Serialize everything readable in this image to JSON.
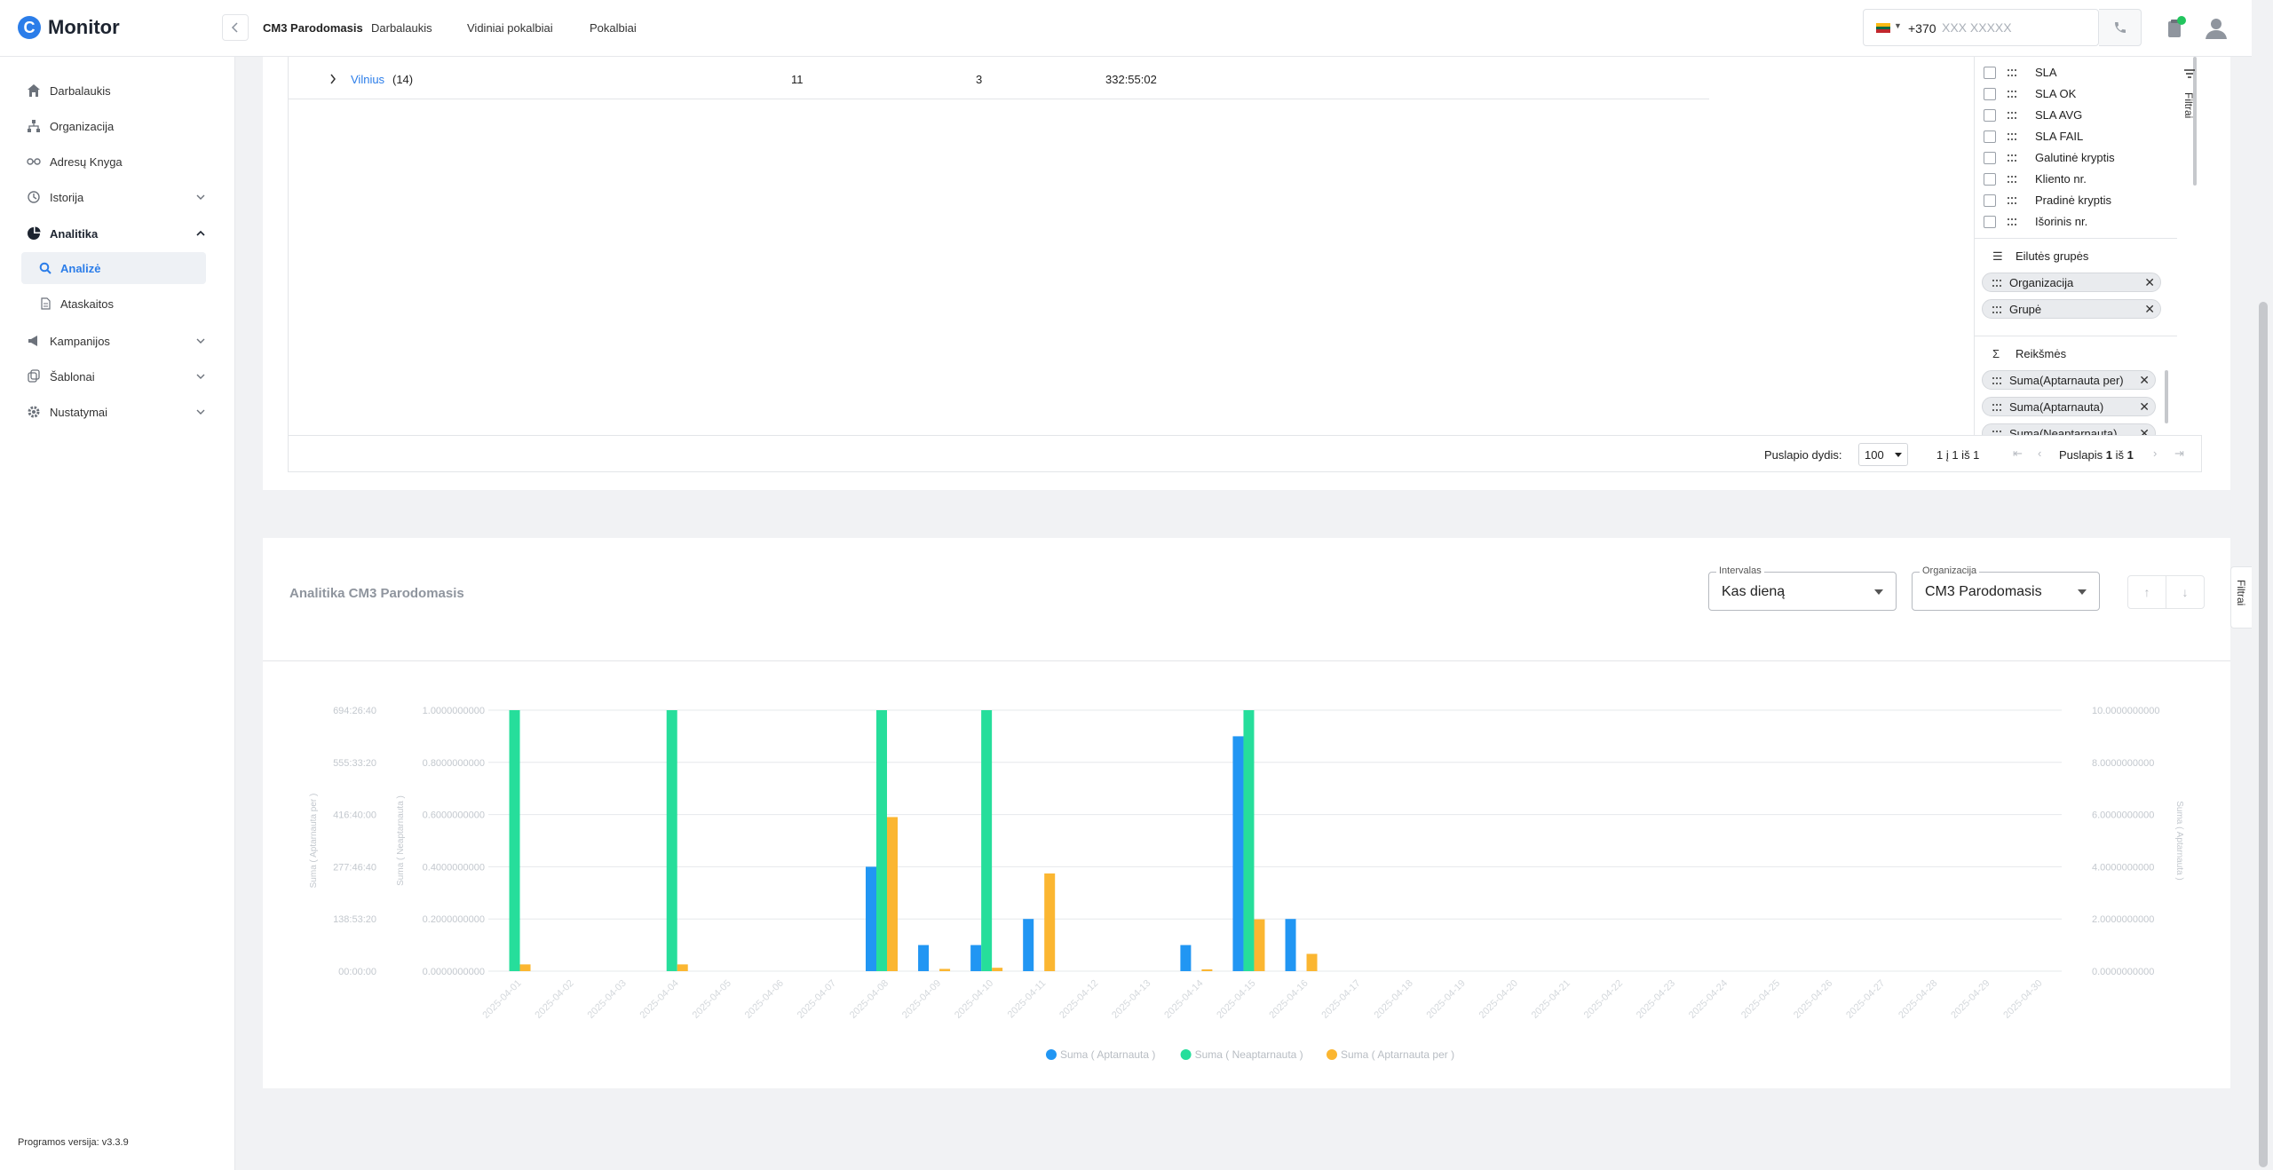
{
  "app": {
    "name": "Monitor",
    "logo_letter": "C",
    "version": "Programos versija: v3.3.9"
  },
  "header": {
    "title": "CM3 Parodomasis",
    "links": [
      "Darbalaukis",
      "Vidiniai pokalbiai",
      "Pokalbiai"
    ],
    "phone_code": "+370",
    "phone_placeholder": "XXX XXXXX",
    "flag_colors": [
      "#fdb913",
      "#006a44",
      "#c1272d"
    ]
  },
  "sidebar": {
    "items": [
      {
        "label": "Darbalaukis",
        "icon": "home-icon"
      },
      {
        "label": "Organizacija",
        "icon": "org-icon"
      },
      {
        "label": "Adresų Knyga",
        "icon": "address-book-icon"
      },
      {
        "label": "Istorija",
        "icon": "history-icon",
        "expandable": true
      },
      {
        "label": "Analitika",
        "icon": "analytics-icon",
        "expanded": true
      },
      {
        "label": "Kampanijos",
        "icon": "megaphone-icon",
        "expandable": true
      },
      {
        "label": "Šablonai",
        "icon": "templates-icon",
        "expandable": true
      },
      {
        "label": "Nustatymai",
        "icon": "gear-icon",
        "expandable": true
      }
    ],
    "sub_items": [
      {
        "label": "Analizė",
        "icon": "search-icon",
        "active": true
      },
      {
        "label": "Ataskaitos",
        "icon": "document-icon"
      }
    ]
  },
  "table": {
    "row": {
      "city": "Vilnius",
      "count": "(14)",
      "col1": "11",
      "col2": "3",
      "col3": "332:55:02"
    },
    "pager": {
      "size_label": "Puslapio dydis:",
      "size_value": "100",
      "range": "1 į 1 iš 1",
      "page_prefix": "Puslapis",
      "page_current": "1",
      "page_mid": "iš",
      "page_total": "1"
    }
  },
  "tool_panel": {
    "columns": [
      "SLA",
      "SLA OK",
      "SLA AVG",
      "SLA FAIL",
      "Galutinė kryptis",
      "Kliento nr.",
      "Pradinė kryptis",
      "Išorinis nr."
    ],
    "row_groups_title": "Eilutės grupės",
    "row_groups": [
      "Organizacija",
      "Grupė"
    ],
    "values_title": "Reikšmės",
    "values": [
      "Suma(Aptarnauta per)",
      "Suma(Aptarnauta)",
      "Suma(Neaptarnauta)"
    ],
    "filter_tab": "Filtrai"
  },
  "chart_panel": {
    "title": "Analitika CM3 Parodomasis",
    "interval_legend": "Intervalas",
    "interval_value": "Kas dieną",
    "org_legend": "Organizacija",
    "org_value": "CM3 Parodomasis",
    "filter_tab": "Filtrai",
    "up_icon": "arrow-up-icon",
    "down_icon": "arrow-down-icon"
  },
  "chart_data": {
    "type": "bar",
    "categories": [
      "2025-04-01",
      "2025-04-02",
      "2025-04-03",
      "2025-04-04",
      "2025-04-05",
      "2025-04-06",
      "2025-04-07",
      "2025-04-08",
      "2025-04-09",
      "2025-04-10",
      "2025-04-11",
      "2025-04-12",
      "2025-04-13",
      "2025-04-14",
      "2025-04-15",
      "2025-04-16",
      "2025-04-17",
      "2025-04-18",
      "2025-04-19",
      "2025-04-20",
      "2025-04-21",
      "2025-04-22",
      "2025-04-23",
      "2025-04-24",
      "2025-04-25",
      "2025-04-26",
      "2025-04-27",
      "2025-04-28",
      "2025-04-29",
      "2025-04-30"
    ],
    "series": [
      {
        "name": "Suma ( Aptarnauta )",
        "color": "#2196f3",
        "axis": "right",
        "values": [
          0,
          0,
          0,
          0,
          0,
          0,
          0,
          4,
          1,
          1,
          2,
          0,
          0,
          1,
          9,
          2,
          0,
          0,
          0,
          0,
          0,
          0,
          0,
          0,
          0,
          0,
          0,
          0,
          0,
          0
        ]
      },
      {
        "name": "Suma ( Neaptarnauta )",
        "color": "#26de9b",
        "axis": "left-inner",
        "values": [
          1,
          0,
          0,
          1,
          0,
          0,
          0,
          1,
          0,
          1,
          0,
          0,
          0,
          0,
          1,
          0,
          0,
          0,
          0,
          0,
          0,
          0,
          0,
          0,
          0,
          0,
          0,
          0,
          0,
          0
        ]
      },
      {
        "name": "Suma ( Aptarnauta per )",
        "color": "#fbb631",
        "axis": "left-outer",
        "values_hours": [
          18,
          0,
          0,
          18,
          0,
          0,
          0,
          410,
          6,
          9,
          260,
          0,
          0,
          4,
          138,
          46,
          0,
          0,
          0,
          0,
          0,
          0,
          0,
          0,
          0,
          0,
          0,
          0,
          0,
          0
        ]
      }
    ],
    "axes": {
      "left_outer": {
        "label": "Suma ( Aptarnauta per )",
        "ticks": [
          "00:00:00",
          "138:53:20",
          "277:46:40",
          "416:40:00",
          "555:33:20",
          "694:26:40"
        ],
        "max_hours": 694.44
      },
      "left_inner": {
        "label": "Suma ( Neaptarnauta )",
        "ticks": [
          "0.0000000000",
          "0.2000000000",
          "0.4000000000",
          "0.6000000000",
          "0.8000000000",
          "1.0000000000"
        ],
        "max": 1
      },
      "right": {
        "label": "Suma ( Aptarnauta )",
        "ticks": [
          "0.0000000000",
          "2.0000000000",
          "4.0000000000",
          "6.0000000000",
          "8.0000000000",
          "10.0000000000"
        ],
        "max": 10
      }
    },
    "legend_position": "bottom",
    "grid": true
  }
}
